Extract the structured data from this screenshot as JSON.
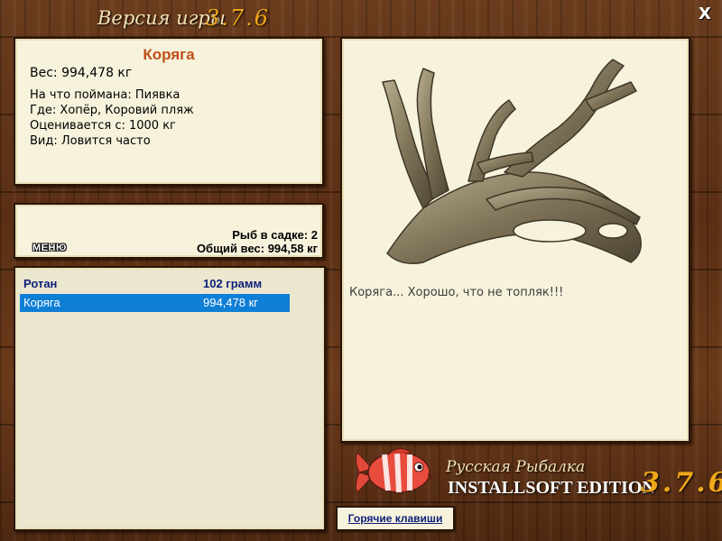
{
  "title": {
    "text": "Версия игры",
    "version": "3.7.6"
  },
  "close_label": "X",
  "info": {
    "name": "Коряга",
    "weight": "Вес: 994,478 кг",
    "details": [
      "На что поймана: Пиявка",
      "Где: Хопёр, Коровий пляж",
      "Оценивается с: 1000 кг",
      "Вид: Ловится часто"
    ]
  },
  "status": {
    "menu_label": "МЕНЮ",
    "fish_count": "Рыб в садке: 2",
    "total_weight": "Общий вес: 994,58 кг"
  },
  "catch_list": [
    {
      "name": "Ротан",
      "weight": "102 грамм"
    },
    {
      "name": "Коряга",
      "weight": "994,478 кг"
    }
  ],
  "image_panel": {
    "icon": "driftwood-image",
    "caption": "Коряга... Хорошо, что не топляк!!!"
  },
  "brand": {
    "line1": "Русская Рыбалка",
    "line2": "INSTALLSOFT EDITION",
    "version": "3.7.6"
  },
  "hotkeys_label": "Горячие клавиши",
  "colors": {
    "accent_orange": "#f0a818",
    "name_color": "#c0501a",
    "selection": "#0f7fd6",
    "header_blue": "#0a1f7a",
    "panel_bg": "#f7f2dc"
  }
}
